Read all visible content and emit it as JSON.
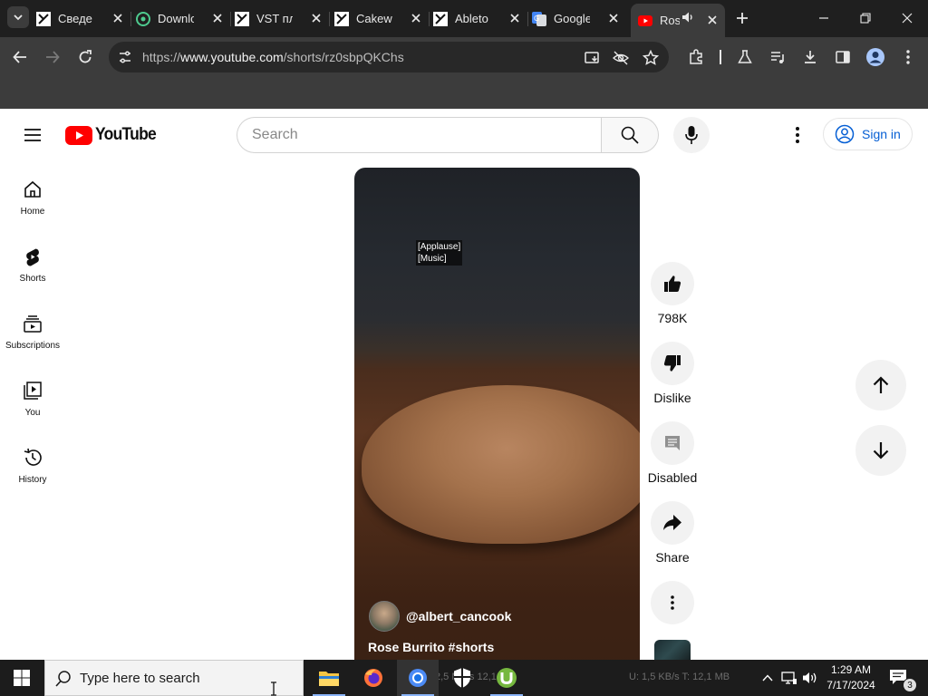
{
  "browser": {
    "tabs": [
      {
        "title": "Сведе",
        "icon": "cakewalk-icon"
      },
      {
        "title": "Downlo",
        "icon": "download-site-icon"
      },
      {
        "title": "VST пл",
        "icon": "cakewalk-icon"
      },
      {
        "title": "Cakew",
        "icon": "cakewalk-icon"
      },
      {
        "title": "Ableto",
        "icon": "cakewalk-icon"
      },
      {
        "title": "Google",
        "icon": "google-translate-icon"
      },
      {
        "title": "Ros",
        "icon": "youtube-icon",
        "active": true,
        "audio": true
      }
    ],
    "url_prefix": "https://",
    "url_host": "www.youtube.com",
    "url_path": "/shorts/rz0sbpQKChs"
  },
  "youtube": {
    "logo_text": "YouTube",
    "search_placeholder": "Search",
    "signin_label": "Sign in",
    "guide": [
      {
        "label": "Home",
        "icon": "home-icon"
      },
      {
        "label": "Shorts",
        "icon": "shorts-icon"
      },
      {
        "label": "Subscriptions",
        "icon": "subscriptions-icon"
      },
      {
        "label": "You",
        "icon": "you-icon"
      },
      {
        "label": "History",
        "icon": "history-icon"
      }
    ],
    "short": {
      "captions": [
        "[Applause]",
        "[Music]"
      ],
      "channel_handle": "@albert_cancook",
      "title": "Rose Burrito #shorts"
    },
    "actions": {
      "like_count": "798K",
      "dislike_label": "Dislike",
      "comments_label": "Disabled",
      "share_label": "Share"
    }
  },
  "taskbar": {
    "search_placeholder": "Type here to search",
    "ghost_left": "2,5 MB/s  12,1 GB",
    "ghost_right": "U: 1,5 KB/s  T: 12,1 MB",
    "time": "1:29 AM",
    "date": "7/17/2024",
    "notification_count": "3",
    "accent_color": "#8ab4f8"
  },
  "colors": {
    "youtube_red": "#ff0000",
    "signin_blue": "#065fd4"
  }
}
